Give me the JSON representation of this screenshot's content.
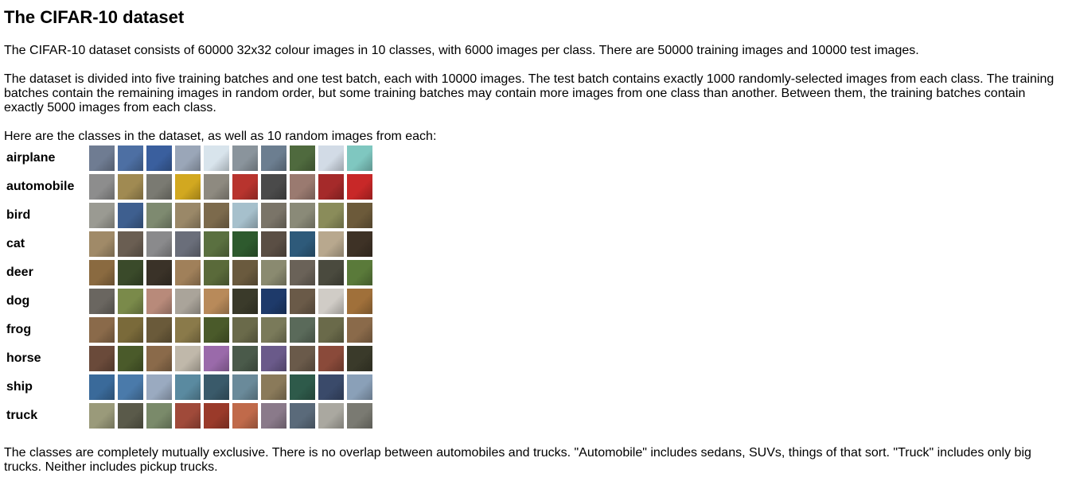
{
  "title": "The CIFAR-10 dataset",
  "paragraphs": {
    "intro": "The CIFAR-10 dataset consists of 60000 32x32 colour images in 10 classes, with 6000 images per class. There are 50000 training images and 10000 test images.",
    "batches": "The dataset is divided into five training batches and one test batch, each with 10000 images. The test batch contains exactly 1000 randomly-selected images from each class. The training batches contain the remaining images in random order, but some training batches may contain more images from one class than another. Between them, the training batches contain exactly 5000 images from each class.",
    "classes_intro": "Here are the classes in the dataset, as well as 10 random images from each:",
    "exclusivity": "The classes are completely mutually exclusive. There is no overlap between automobiles and trucks. \"Automobile\" includes sedans, SUVs, things of that sort. \"Truck\" includes only big trucks. Neither includes pickup trucks."
  },
  "classes": [
    {
      "label": "airplane",
      "colors": [
        "#6f7c92",
        "#4d6fa3",
        "#3a5f9e",
        "#9aa6b8",
        "#d8e4ec",
        "#8a949c",
        "#6c7e90",
        "#4f6a3e",
        "#d2dbe6",
        "#7fc7c0"
      ]
    },
    {
      "label": "automobile",
      "colors": [
        "#8d8d8d",
        "#a08a52",
        "#7a7a72",
        "#d2a820",
        "#8e8a80",
        "#b8342e",
        "#4a4a4a",
        "#9a7a70",
        "#a52a2a",
        "#c82828"
      ]
    },
    {
      "label": "bird",
      "colors": [
        "#9a9a92",
        "#3e5f8f",
        "#7e8a70",
        "#9a8868",
        "#7c6a4c",
        "#a6c0cc",
        "#7a7468",
        "#8a8a78",
        "#8a8c5a",
        "#6c5a3a"
      ]
    },
    {
      "label": "cat",
      "colors": [
        "#a08a68",
        "#6a5e52",
        "#8a8a8c",
        "#6a6e7a",
        "#5a7040",
        "#2e5a2e",
        "#5a4e44",
        "#2e5a7a",
        "#b8a88e",
        "#3e3226"
      ]
    },
    {
      "label": "deer",
      "colors": [
        "#8a6a40",
        "#3a4a2a",
        "#3a3228",
        "#a0805a",
        "#5a6a3a",
        "#6a5a3e",
        "#8a8a70",
        "#6a6258",
        "#4a4a3e",
        "#5a7a3a"
      ]
    },
    {
      "label": "dog",
      "colors": [
        "#6a6660",
        "#7a8a4a",
        "#b88a7a",
        "#aaa49a",
        "#b88a5a",
        "#3a3a2a",
        "#1e3a6a",
        "#6a5a48",
        "#d0ccc6",
        "#a0703a"
      ]
    },
    {
      "label": "frog",
      "colors": [
        "#8a6a4a",
        "#7a6a3a",
        "#6a5a3a",
        "#8a7a4a",
        "#4a5a2a",
        "#6a6a4a",
        "#7a7a5a",
        "#5a6a5a",
        "#6a6a4a",
        "#8a6a4a"
      ]
    },
    {
      "label": "horse",
      "colors": [
        "#6a4a3a",
        "#4a5a2a",
        "#8a6a4a",
        "#c0b8aa",
        "#9a6aaa",
        "#4a5a4a",
        "#6a5a8a",
        "#6a5a4a",
        "#8a4a3a",
        "#3a3a2a"
      ]
    },
    {
      "label": "ship",
      "colors": [
        "#3a6a9a",
        "#4a7aaa",
        "#9aaac0",
        "#5a8aa0",
        "#3a5a6a",
        "#6a8a9a",
        "#8a7a5a",
        "#2e5a4a",
        "#3a4a6a",
        "#8aa0b8"
      ]
    },
    {
      "label": "truck",
      "colors": [
        "#9a9a7a",
        "#5a5a4a",
        "#7a8a6a",
        "#a04a3a",
        "#9a3a2a",
        "#c06a4a",
        "#8a7a8a",
        "#5a6a7a",
        "#aaa8a0",
        "#7a7a72"
      ]
    }
  ]
}
